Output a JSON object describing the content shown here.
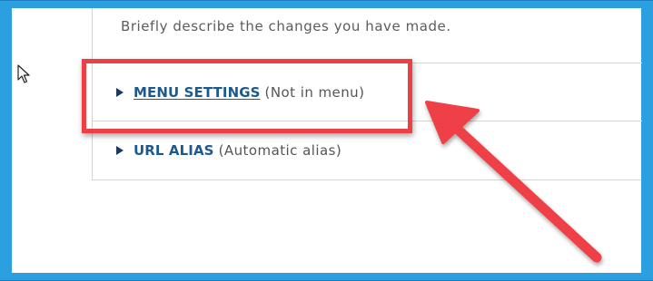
{
  "form": {
    "description_help": "Briefly describe the changes you have made.",
    "sections": [
      {
        "title": "MENU SETTINGS",
        "summary": "(Not in menu)",
        "expanded": false
      },
      {
        "title": "URL ALIAS",
        "summary": "(Automatic alias)",
        "expanded": false
      }
    ]
  },
  "annotation": {
    "highlight_color": "#ef3f46",
    "arrow_color": "#ef3f46",
    "frame_color": "#2b9fe0",
    "link_color": "#1c5a8e"
  },
  "icons": {
    "expand": "triangle-right-icon",
    "pointer": "mouse-pointer-icon"
  }
}
